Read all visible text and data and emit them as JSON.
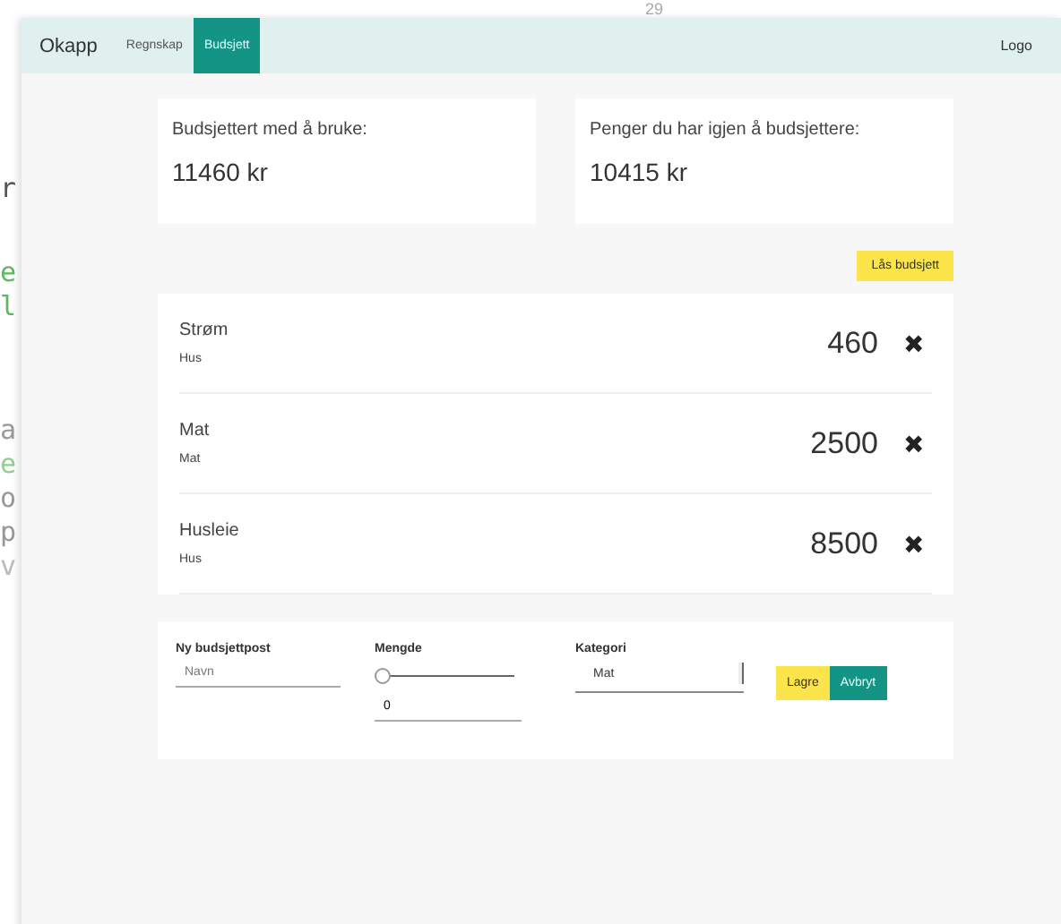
{
  "background": {
    "top_text": "29",
    "side_letters": [
      {
        "text": "r",
        "color": "#555555"
      },
      {
        "text": "e",
        "color": "#5cb85c"
      },
      {
        "text": "l",
        "color": "#5cb85c"
      },
      {
        "text": "a",
        "color": "#999999"
      },
      {
        "text": "e",
        "color": "#8fcf8f"
      },
      {
        "text": "o",
        "color": "#999999"
      },
      {
        "text": "p",
        "color": "#999999"
      },
      {
        "text": "v",
        "color": "#bbbbbb"
      }
    ]
  },
  "navbar": {
    "brand": "Okapp",
    "tabs": [
      {
        "label": "Regnskap",
        "selected": false
      },
      {
        "label": "Budsjett",
        "selected": true
      }
    ],
    "logout": "Logo"
  },
  "summary": [
    {
      "label": "Budsjettert med å bruke:",
      "value": "11460 kr"
    },
    {
      "label": "Penger du har igjen å budsjettere:",
      "value": "10415 kr"
    }
  ],
  "lock_button": "Lås budsjett",
  "items": [
    {
      "name": "Strøm",
      "category": "Hus",
      "amount": "460",
      "delete": "✖"
    },
    {
      "name": "Mat",
      "category": "Mat",
      "amount": "2500",
      "delete": "✖"
    },
    {
      "name": "Husleie",
      "category": "Hus",
      "amount": "8500",
      "delete": "✖"
    }
  ],
  "form": {
    "name_label": "Ny budsjettpost",
    "name_placeholder": "Navn",
    "amount_label": "Mengde",
    "amount_slider": {
      "level": 0
    },
    "amount_value": "0",
    "category_label": "Kategori",
    "category_value": "Mat",
    "save": "Lagre",
    "cancel": "Avbryt"
  }
}
